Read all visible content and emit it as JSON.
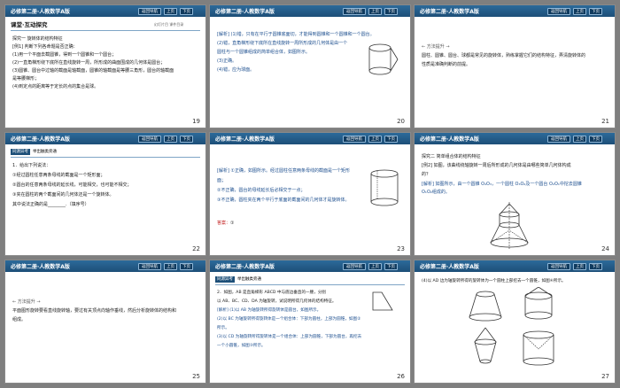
{
  "header": {
    "title": "必修第二册·人教数学A版",
    "nav_return": "返回导航",
    "nav_prev": "上页",
    "nav_next": "下页"
  },
  "slides": {
    "s19": {
      "page": "19",
      "section": "课堂·互动探究",
      "section_sub": "幻灯片目 课件目录",
      "lines": [
        "探究一 旋转体的结构特征",
        "[例1] 判断下列各命题是否正确：",
        "(1)用一个平面去截圆锥，得到一个圆锥和一个圆台；",
        "(2)一直角梯形绕下底所在直线旋转一周，所形成的曲面围成的几何体是圆台；",
        "(3)圆锥、圆台中过轴的截面是轴截面，圆锥的轴截面是等腰三角形，圆台的轴截面",
        "是等腰梯形；",
        "(4)到定点的距离等于定长的点的集合是球。"
      ]
    },
    "s20": {
      "page": "20",
      "lines": [
        "[解析] (1)错，只有在平行于圆锥底面切，才能得到圆锥和一个圆锥和一个圆台。",
        "(2)错，直角梯形绕下底所在直线旋转一周所形成的几何体是由一个",
        "圆柱与一个圆锥组成的简单组合体，如图所示。",
        "(3)正确。",
        "(4)错，应为球面。"
      ]
    },
    "s21": {
      "page": "21",
      "lines": [
        "← 方法提升 →",
        "圆柱、圆锥、圆台、球都是常见的旋转体，熟练掌握它们的结构特征，弄清旋转体的",
        "性质是准确判断的前提。"
      ]
    },
    "s22": {
      "page": "22",
      "tag": "同源异考",
      "tag_note": "举出触类旁通",
      "lines": [
        "1．给出下列说法：",
        "①经过圆柱任意两条母线的截面是一个矩形面；",
        "②圆台的任意两条母线的延长线，可能相交，也可能不相交；",
        "③夹在圆柱的两个截面间的几何体还是一个旋转体。",
        "其中说法正确的是________.（填序号）"
      ]
    },
    "s23": {
      "page": "23",
      "lines": [
        "[解析] ①正确，如图所示。经过圆柱任意两条母线的截面是一个矩形",
        "面；",
        "②不正确，圆台的母线延长后必相交于一点；",
        "③不正确，圆柱夹在两个平行于底面的截面间的几何体才是旋转体。"
      ],
      "answer_label": "答案：",
      "answer": "①"
    },
    "s24": {
      "page": "24",
      "lines": [
        "探究二 简单组合体的结构特征",
        "[例2] 如图，该曲线绕轴旋转一周后所形成的几何体是由哪些简单几何体构成",
        "的？"
      ],
      "solution": "[解析] 如图所示，由一个圆锥 O₄O₃，一个圆柱 O₃O₂及一个圆台 O₂O₁中挖去圆锥",
      "solution2": "O₁O₂组成的。"
    },
    "s25": {
      "page": "25",
      "lines": [
        "← 方法提升 →",
        "平面图形旋转要看直线旋转轴，要过有关顶点向轴作垂线，然后分析旋转体的结构和",
        "组成。"
      ]
    },
    "s26": {
      "page": "26",
      "tag": "同源异考",
      "tag_note": "举出触类旁通",
      "lines": [
        "2．如图，AB 是直角梯形 ABCD 中与底边垂直的一腰，分别",
        "以 AB、BC、CD、DA 为轴旋转，试说明所得几何体的结构特征。",
        "[解析] (1)以 AB 为轴旋转所得旋转体是圆台，如图所示。",
        "(2)以 BC 为轴旋转所得旋转体是一个组合体：下部为圆柱，上部为圆锥，如图②",
        "所示。",
        "(3)以 CD 为轴旋转所得旋转体是一个组合体：上部为圆锥，下部为圆台，再挖去",
        "一个小圆锥，如图③所示。"
      ]
    },
    "s27": {
      "page": "27",
      "lines": [
        "(4)以 AD 边为轴旋转所得的旋转体为一个圆柱上部挖去一个圆锥，如图④所示。"
      ]
    }
  },
  "colors": {
    "header": "#1d4f78",
    "answer": "#c21f1f",
    "explain": "#1d4f8f"
  }
}
